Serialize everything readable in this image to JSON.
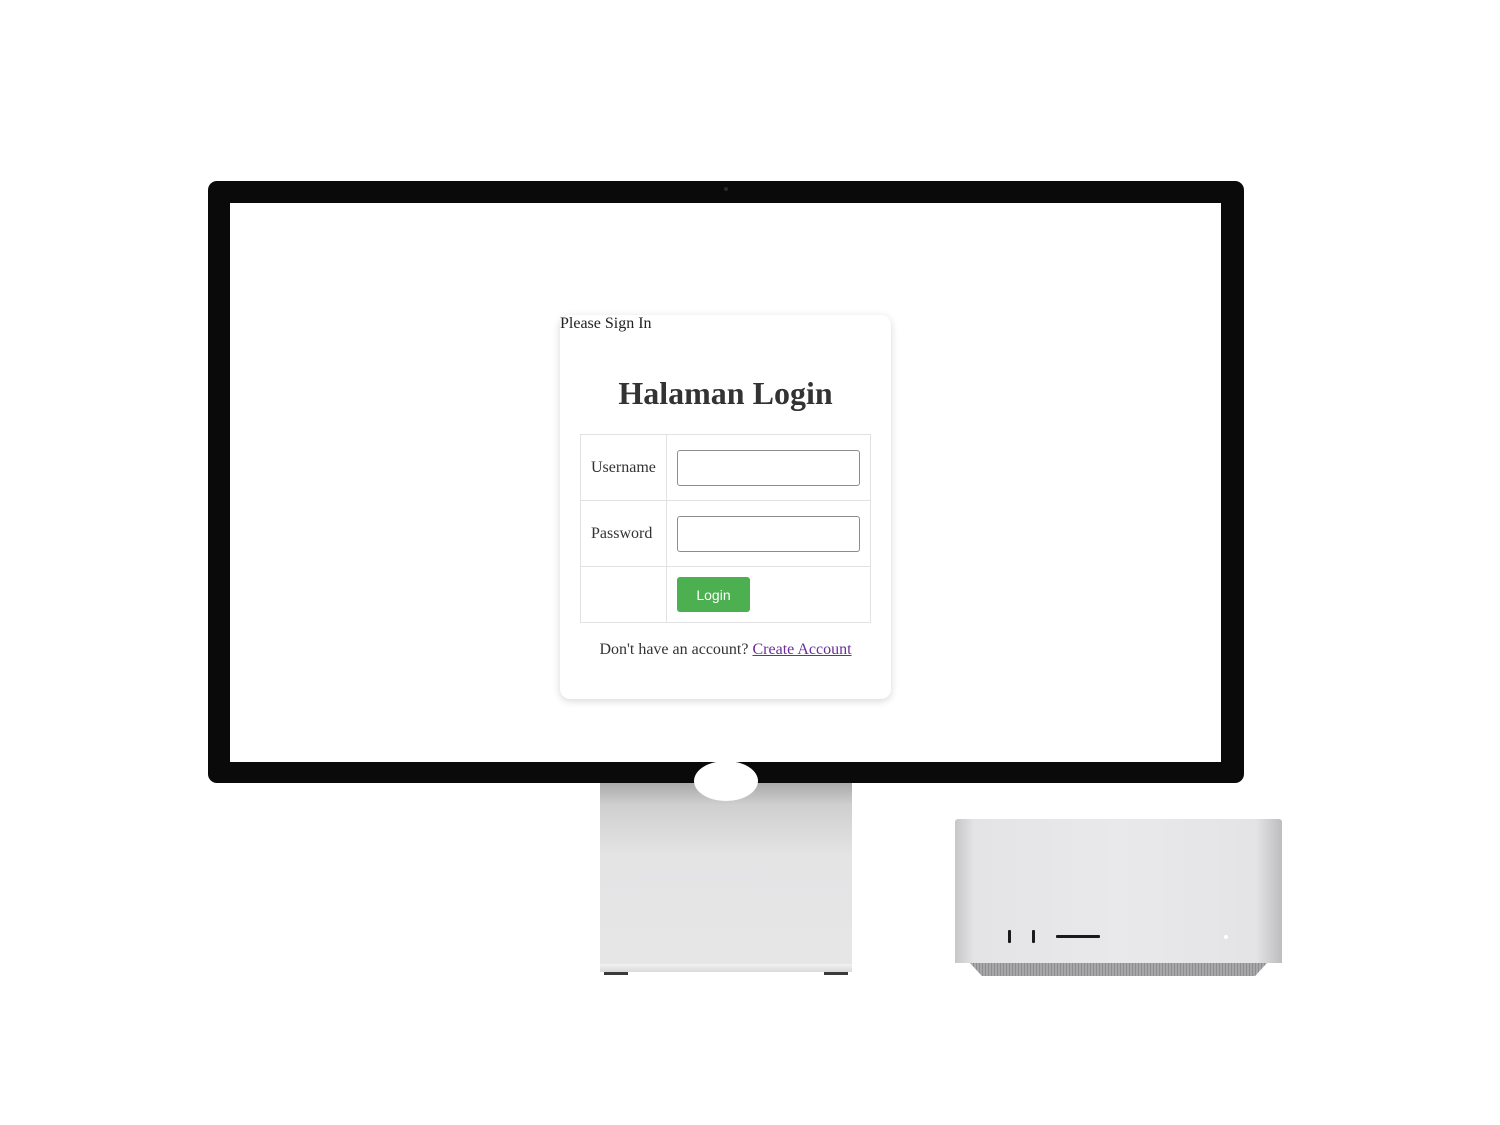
{
  "login_page": {
    "legend": "Please Sign In",
    "title": "Halaman Login",
    "username_label": "Username",
    "username_value": "",
    "password_label": "Password",
    "password_value": "",
    "login_button": "Login",
    "signup_prompt": "Don't have an account?",
    "signup_link": "Create Account"
  },
  "colors": {
    "login_button": "#4caf50",
    "link": "#6b2d9a",
    "text": "#333333"
  },
  "devices": {
    "monitor_icon": "studio-display",
    "desktop_icon": "mac-studio"
  }
}
